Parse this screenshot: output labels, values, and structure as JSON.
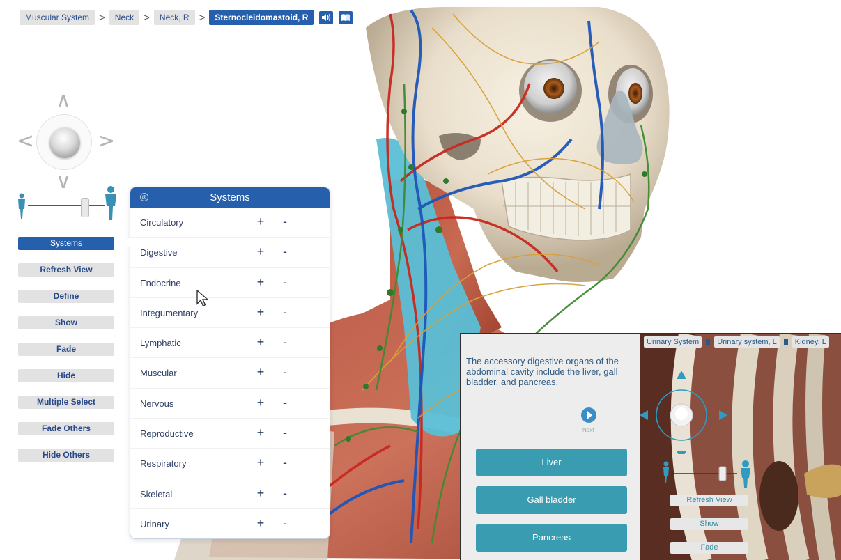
{
  "breadcrumb": [
    "Muscular System",
    "Neck",
    "Neck, R",
    "Sternocleidomastoid, R"
  ],
  "breadcrumb_separator": ">",
  "toolbar_icons": [
    "speaker-icon",
    "book-icon"
  ],
  "nav_arrows": {
    "up": "∧",
    "down": "∨",
    "left": "<",
    "right": ">"
  },
  "left_buttons": [
    "Systems",
    "Refresh View",
    "Define",
    "Show",
    "Fade",
    "Hide",
    "Multiple Select",
    "Fade Others",
    "Hide Others"
  ],
  "systems_panel": {
    "title": "Systems",
    "close_glyph": "⊗",
    "plus": "+",
    "minus": "-",
    "items": [
      "Circulatory",
      "Digestive",
      "Endocrine",
      "Integumentary",
      "Lymphatic",
      "Muscular",
      "Nervous",
      "Reproductive",
      "Respiratory",
      "Skeletal",
      "Urinary"
    ]
  },
  "quiz": {
    "question": "The accessory digestive organs of the abdominal cavity include the liver, gall bladder, and pancreas.",
    "next_label": "Next",
    "answers": [
      "Liver",
      "Gall bladder",
      "Pancreas"
    ]
  },
  "inset_view": {
    "breadcrumb": [
      "Urinary System",
      "Urinary system, L",
      "Kidney, L"
    ],
    "buttons": [
      "Refresh View",
      "Show",
      "Fade"
    ]
  },
  "colors": {
    "accent_blue": "#2660ac",
    "teal": "#3a9cb1",
    "highlight_muscle": "#5bbfd6"
  }
}
